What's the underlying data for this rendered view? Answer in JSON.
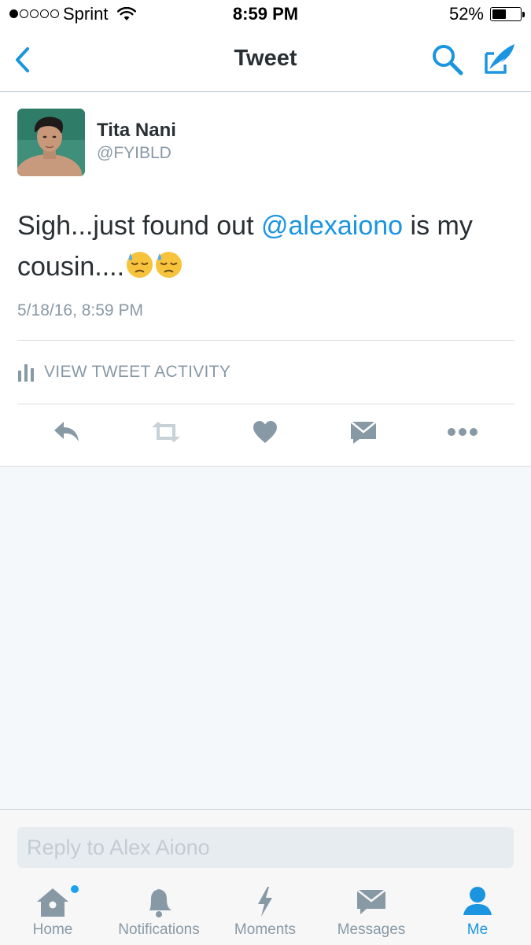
{
  "status_bar": {
    "carrier": "Sprint",
    "time": "8:59 PM",
    "battery_percent": "52%",
    "battery_level": 0.52,
    "signal_bars": 1,
    "signal_total": 5
  },
  "nav": {
    "title": "Tweet",
    "back_icon": "chevron-left-icon",
    "search_icon": "search-icon",
    "compose_icon": "compose-icon"
  },
  "tweet": {
    "author_name": "Tita Nani",
    "author_handle": "@FYIBLD",
    "text_before": "Sigh...just found out ",
    "mention": "@alexaiono",
    "text_after": " is my cousin....",
    "emoji": "downcast-face-with-sweat-emoji",
    "emoji_count": 2,
    "timestamp": "5/18/16, 8:59 PM",
    "activity_label": "VIEW TWEET ACTIVITY"
  },
  "actions": [
    "reply-icon",
    "retweet-icon",
    "like-icon",
    "direct-message-icon",
    "more-icon"
  ],
  "reply": {
    "placeholder": "Reply to Alex Aiono",
    "value": ""
  },
  "tabs": [
    {
      "label": "Home",
      "icon": "home-icon",
      "active": false,
      "badge": true
    },
    {
      "label": "Notifications",
      "icon": "bell-icon",
      "active": false
    },
    {
      "label": "Moments",
      "icon": "lightning-icon",
      "active": false
    },
    {
      "label": "Messages",
      "icon": "envelope-icon",
      "active": false
    },
    {
      "label": "Me",
      "icon": "person-icon",
      "active": true
    }
  ],
  "colors": {
    "accent": "#1b95e0",
    "icon_gray": "#8899a6",
    "text": "#292f33",
    "background_gray": "#f5f8fa"
  }
}
